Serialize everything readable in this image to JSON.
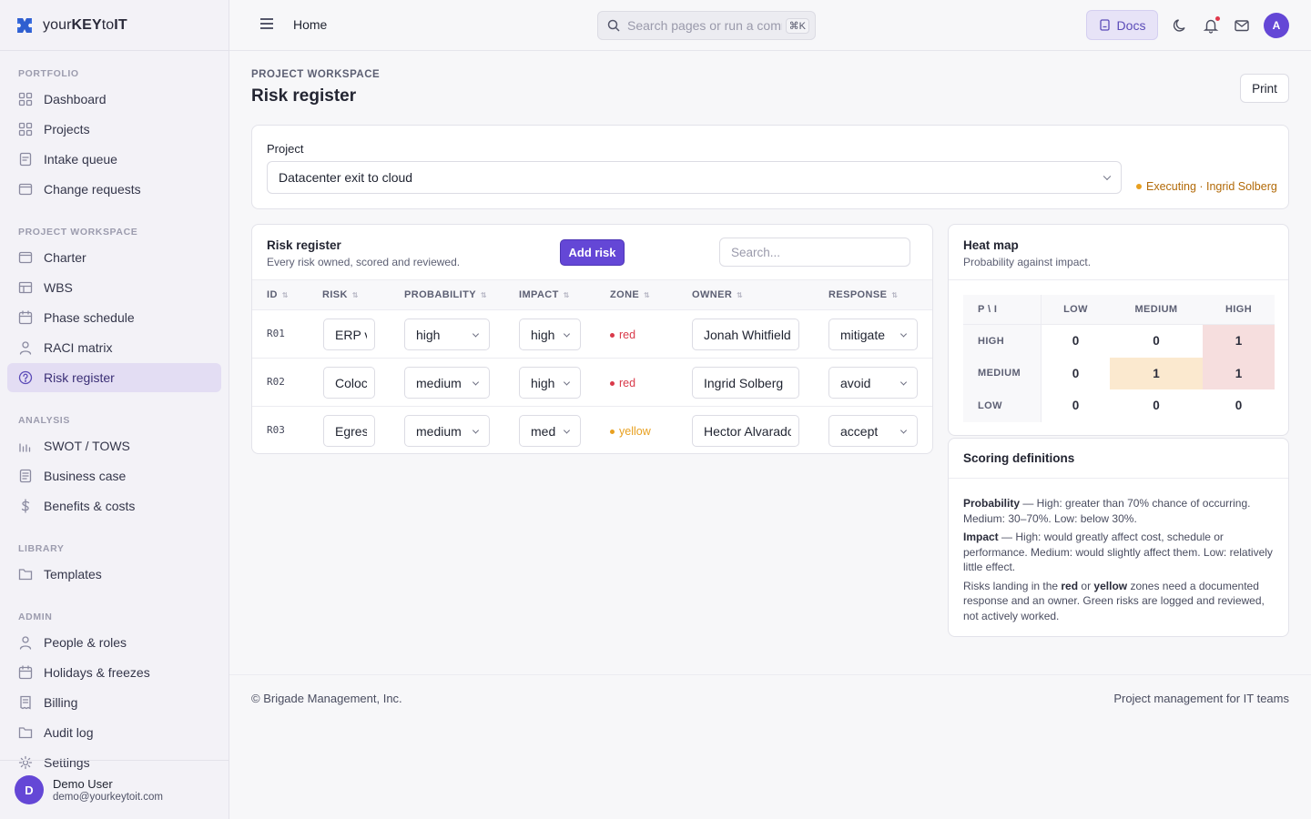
{
  "brand": {
    "prefix": "your",
    "key": "KEY",
    "middle": "to",
    "it": "IT"
  },
  "sidebar": {
    "sections": [
      {
        "title": "PORTFOLIO",
        "items": [
          {
            "label": "Dashboard",
            "icon": "grid-icon"
          },
          {
            "label": "Projects",
            "icon": "grid-icon"
          },
          {
            "label": "Intake queue",
            "icon": "inbox-icon"
          },
          {
            "label": "Change requests",
            "icon": "window-icon"
          }
        ]
      },
      {
        "title": "PROJECT WORKSPACE",
        "items": [
          {
            "label": "Charter",
            "icon": "window-icon"
          },
          {
            "label": "WBS",
            "icon": "table-icon"
          },
          {
            "label": "Phase schedule",
            "icon": "calendar-icon"
          },
          {
            "label": "RACI matrix",
            "icon": "person-icon"
          },
          {
            "label": "Risk register",
            "icon": "question-circle-icon",
            "active": true
          }
        ]
      },
      {
        "title": "ANALYSIS",
        "items": [
          {
            "label": "SWOT / TOWS",
            "icon": "bars-icon"
          },
          {
            "label": "Business case",
            "icon": "document-icon"
          },
          {
            "label": "Benefits & costs",
            "icon": "dollar-icon"
          }
        ]
      },
      {
        "title": "LIBRARY",
        "items": [
          {
            "label": "Templates",
            "icon": "folder-icon"
          }
        ]
      },
      {
        "title": "ADMIN",
        "items": [
          {
            "label": "People & roles",
            "icon": "person-icon"
          },
          {
            "label": "Holidays & freezes",
            "icon": "calendar-icon"
          },
          {
            "label": "Billing",
            "icon": "receipt-icon"
          },
          {
            "label": "Audit log",
            "icon": "folder-icon"
          },
          {
            "label": "Settings",
            "icon": "gear-icon"
          }
        ]
      }
    ],
    "user": {
      "initial": "D",
      "name": "Demo User",
      "email": "demo@yourkeytoit.com"
    }
  },
  "topbar": {
    "breadcrumb": "Home",
    "search_placeholder": "Search pages or run a command",
    "shortcut": "⌘K",
    "docs_label": "Docs",
    "avatar_initial": "A"
  },
  "page": {
    "kicker": "PROJECT WORKSPACE",
    "title": "Risk register",
    "print_label": "Print"
  },
  "project": {
    "label": "Project",
    "selected": "Datacenter exit to cloud",
    "status": "Executing · Ingrid Solberg",
    "status_color": "#e8a020"
  },
  "register": {
    "title": "Risk register",
    "subtitle": "Every risk owned, scored and reviewed.",
    "add_label": "Add risk",
    "search_placeholder": "Search...",
    "columns": [
      "ID",
      "RISK",
      "PROBABILITY",
      "IMPACT",
      "ZONE",
      "OWNER",
      "RESPONSE"
    ],
    "rows": [
      {
        "id": "R01",
        "risk": "ERP vendor",
        "probability": "high",
        "impact": "high",
        "zone": "red",
        "owner": "Jonah Whitfield",
        "response": "mitigate"
      },
      {
        "id": "R02",
        "risk": "Colocation",
        "probability": "medium",
        "impact": "high",
        "zone": "red",
        "owner": "Ingrid Solberg",
        "response": "avoid"
      },
      {
        "id": "R03",
        "risk": "Egress",
        "probability": "medium",
        "impact": "medium",
        "zone": "yellow",
        "owner": "Hector Alvarado",
        "response": "accept"
      }
    ],
    "zone_colors": {
      "red": "#d93a4a",
      "yellow": "#e8a020"
    }
  },
  "heatmap": {
    "title": "Heat map",
    "subtitle": "Probability against impact.",
    "corner": "P \\ I",
    "columns": [
      "LOW",
      "MEDIUM",
      "HIGH"
    ],
    "rows": [
      {
        "label": "HIGH",
        "values": [
          "0",
          "0",
          "1"
        ],
        "tints": [
          "",
          "",
          "red"
        ]
      },
      {
        "label": "MEDIUM",
        "values": [
          "0",
          "1",
          "1"
        ],
        "tints": [
          "",
          "yellow",
          "red"
        ]
      },
      {
        "label": "LOW",
        "values": [
          "0",
          "0",
          "0"
        ],
        "tints": [
          "",
          "",
          ""
        ]
      }
    ],
    "tint_colors": {
      "red": "#f6dede",
      "yellow": "#fbe9cf"
    }
  },
  "scoring": {
    "title": "Scoring definitions",
    "p1_bold": "Probability",
    "p1_text": " — High: greater than 70% chance of occurring. Medium: 30–70%. Low: below 30%.",
    "p2_bold": "Impact",
    "p2_text": " — High: would greatly affect cost, schedule or performance. Medium: would slightly affect them. Low: relatively little effect.",
    "p3_a": "Risks landing in the ",
    "p3_red": "red",
    "p3_b": " or ",
    "p3_yellow": "yellow",
    "p3_c": " zones need a documented response and an owner. Green risks are logged and reviewed, not actively worked."
  },
  "footer": {
    "left": "© Brigade Management, Inc.",
    "right": "Project management for IT teams"
  }
}
